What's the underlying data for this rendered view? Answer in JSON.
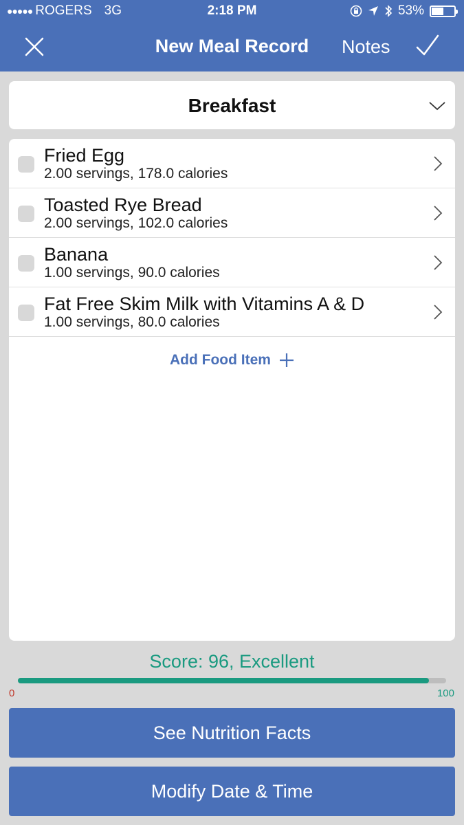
{
  "status_bar": {
    "signal_dots": "●●●●●",
    "carrier": "ROGERS",
    "network": "3G",
    "time": "2:18 PM",
    "battery_percent": "53%",
    "battery_level": 0.53
  },
  "navbar": {
    "title": "New Meal Record",
    "notes_label": "Notes"
  },
  "meal": {
    "selected": "Breakfast"
  },
  "food_items": [
    {
      "name": "Fried Egg",
      "detail": "2.00 servings, 178.0 calories"
    },
    {
      "name": "Toasted Rye Bread",
      "detail": "2.00 servings, 102.0 calories"
    },
    {
      "name": "Banana",
      "detail": "1.00 servings, 90.0 calories"
    },
    {
      "name": "Fat Free Skim Milk with Vitamins A & D",
      "detail": "1.00 servings, 80.0 calories"
    }
  ],
  "add_food_label": "Add Food Item",
  "score": {
    "label": "Score: 96, Excellent",
    "value": 96,
    "min_label": "0",
    "max_label": "100"
  },
  "buttons": {
    "nutrition": "See Nutrition Facts",
    "modify": "Modify Date & Time"
  },
  "colors": {
    "brand_blue": "#4a70b8",
    "score_green": "#1a9a80",
    "min_red": "#c0392b"
  }
}
